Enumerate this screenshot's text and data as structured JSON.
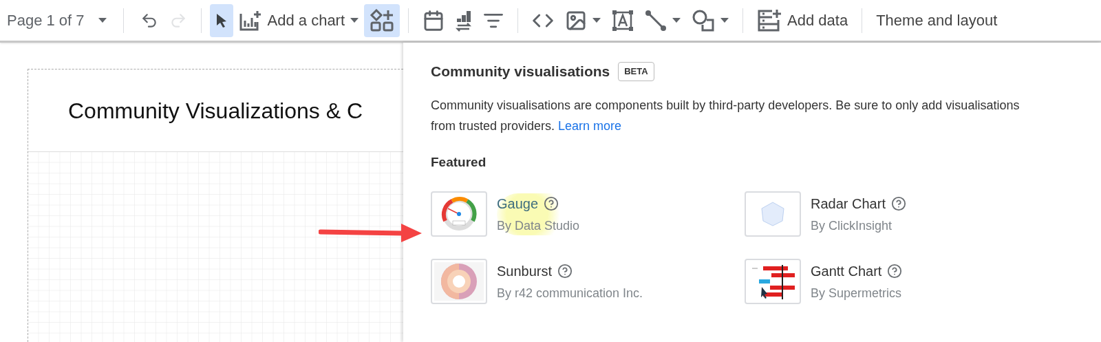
{
  "toolbar": {
    "page_selector": "Page 1 of 7",
    "buttons": [
      {
        "selected": false,
        "disabled": false
      },
      {
        "selected": false,
        "disabled": true
      },
      {
        "selected": true,
        "disabled": false
      },
      {
        "label": "Add a chart",
        "selected": false,
        "disabled": false
      },
      {
        "selected": true,
        "disabled": false
      },
      {
        "selected": false,
        "disabled": false
      },
      {
        "selected": false,
        "disabled": false
      },
      {
        "selected": false,
        "disabled": false
      },
      {
        "selected": false,
        "disabled": false
      },
      {
        "selected": false,
        "disabled": false
      },
      {
        "selected": false,
        "disabled": false
      },
      {
        "selected": false,
        "disabled": false
      },
      {
        "selected": false,
        "disabled": false
      },
      {
        "label": "Add data",
        "selected": false,
        "disabled": false
      }
    ],
    "theme_button": "Theme and layout"
  },
  "canvas": {
    "title": "Community Visualizations & C"
  },
  "panel": {
    "title": "Community visualisations",
    "badge": "BETA",
    "description": "Community visualisations are components built by third-party developers. Be sure to only add visualisations from trusted providers.",
    "link": "Learn more",
    "section": "Featured",
    "items": [
      {
        "name": "Gauge",
        "author": "By Data Studio",
        "hovered": true
      },
      {
        "name": "Radar Chart",
        "author": "By ClickInsight",
        "hovered": false
      },
      {
        "name": "Sunburst",
        "author": "By r42 communication Inc.",
        "hovered": false
      },
      {
        "name": "Gantt Chart",
        "author": "By Supermetrics",
        "hovered": false
      }
    ]
  }
}
